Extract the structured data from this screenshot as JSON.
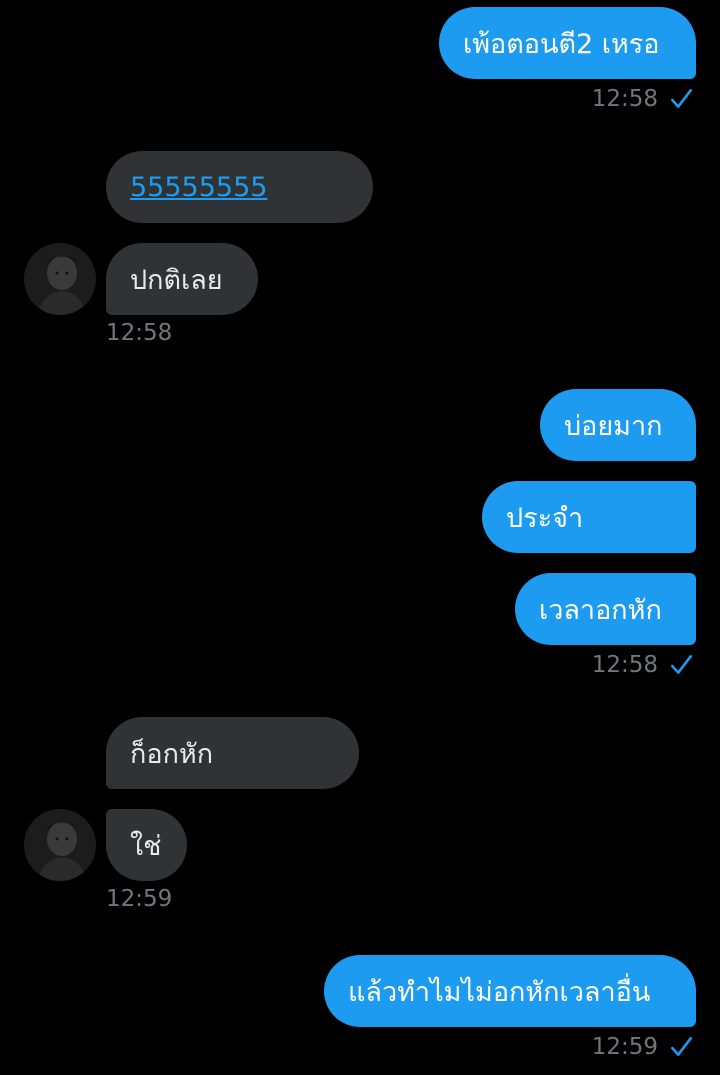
{
  "messages": {
    "m1": {
      "text": "เพ้อตอนตี2 เหรอ",
      "time": "12:58"
    },
    "m2": {
      "text": "55555555"
    },
    "m3": {
      "text": "ปกติเลย",
      "time": "12:58"
    },
    "m4": {
      "text": "บ่อยมาก"
    },
    "m5": {
      "text": "ประจำ"
    },
    "m6": {
      "text": "เวลาอกหัก",
      "time": "12:58"
    },
    "m7": {
      "text": "ก็อกหัก"
    },
    "m8": {
      "text": "ใช่",
      "time": "12:59"
    },
    "m9": {
      "text": "แล้วทำไมไม่อกหักเวลาอื่น",
      "time": "12:59"
    }
  },
  "icons": {
    "read_receipt": "checkmark-icon",
    "avatar": "contact-avatar"
  },
  "colors": {
    "outgoing_bubble": "#1d9bf0",
    "incoming_bubble": "#2f3336",
    "timestamp": "#71767b",
    "background": "#000000"
  }
}
